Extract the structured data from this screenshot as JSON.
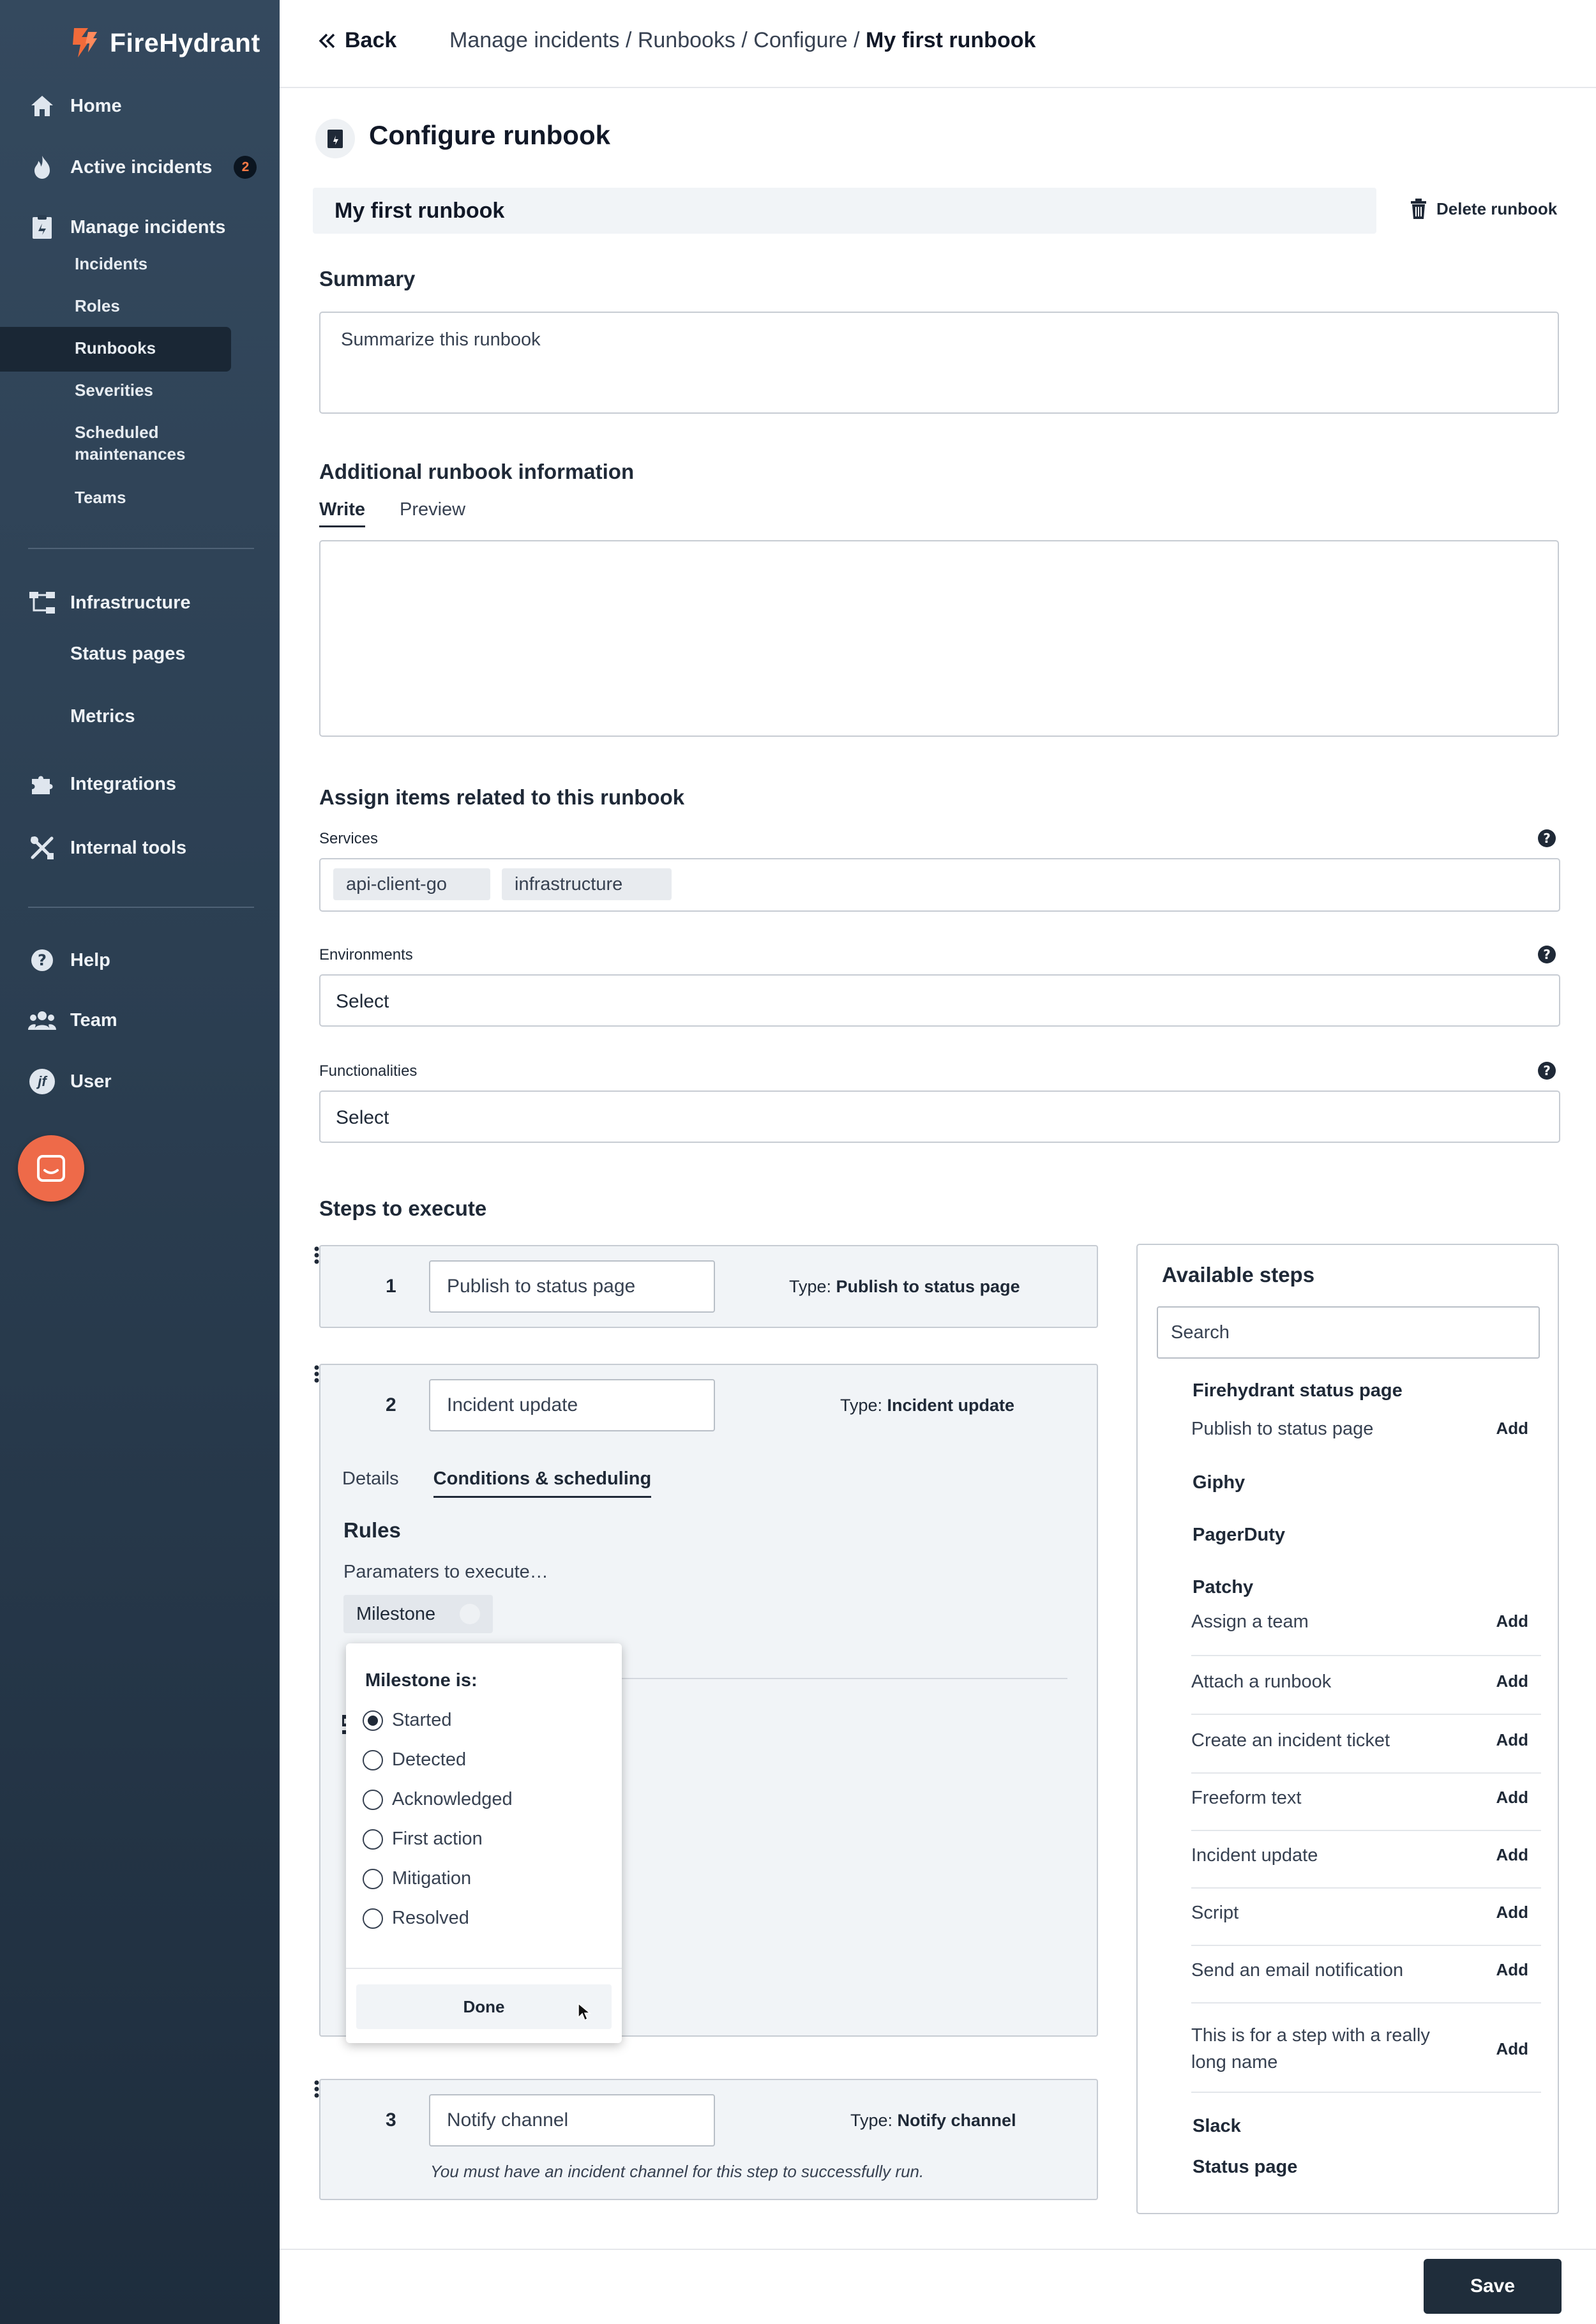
{
  "brand": {
    "name": "FireHydrant",
    "accent": "#f26b3a"
  },
  "sidebar": {
    "home": "Home",
    "active_incidents": "Active incidents",
    "active_incidents_count": "2",
    "manage_incidents": "Manage incidents",
    "sub": [
      "Incidents",
      "Roles",
      "Runbooks",
      "Severities",
      "Scheduled maintenances",
      "Teams"
    ],
    "infrastructure": "Infrastructure",
    "status_pages": "Status pages",
    "metrics": "Metrics",
    "integrations": "Integrations",
    "internal_tools": "Internal tools",
    "help": "Help",
    "team": "Team",
    "user": "User",
    "user_initials": "jf"
  },
  "header": {
    "back": "Back",
    "crumbs": "Manage incidents / Runbooks / Configure / ",
    "crumb_current": "My first runbook"
  },
  "page": {
    "title": "Configure runbook",
    "runbook_name": "My first runbook",
    "delete": "Delete runbook",
    "summary_label": "Summary",
    "summary_placeholder": "Summarize this runbook",
    "additional_label": "Additional runbook information",
    "tab_write": "Write",
    "tab_preview": "Preview",
    "assign_label": "Assign items related to this runbook",
    "services_label": "Services",
    "services": [
      "api-client-go",
      "infrastructure"
    ],
    "environments_label": "Environments",
    "environments_value": "Select",
    "functionalities_label": "Functionalities",
    "functionalities_value": "Select",
    "steps_label": "Steps to execute"
  },
  "steps": [
    {
      "num": "1",
      "name": "Publish to status page",
      "type_prefix": "Type: ",
      "type": "Publish to status page"
    },
    {
      "num": "2",
      "name": "Incident update",
      "type_prefix": "Type: ",
      "type": "Incident update",
      "tab_details": "Details",
      "tab_conditions": "Conditions & scheduling",
      "rules": "Rules",
      "params": "Paramaters to execute…",
      "chip": "Milestone"
    },
    {
      "num": "3",
      "name": "Notify channel",
      "type_prefix": "Type: ",
      "type": "Notify channel",
      "note": "You must have an incident channel for this step to successfully run."
    }
  ],
  "milestone_dropdown": {
    "title": "Milestone is:",
    "options": [
      "Started",
      "Detected",
      "Acknowledged",
      "First action",
      "Mitigation",
      "Resolved"
    ],
    "selected": "Started",
    "done": "Done"
  },
  "available": {
    "title": "Available steps",
    "search_placeholder": "Search",
    "groups": {
      "firehydrant": "Firehydrant status page",
      "giphy": "Giphy",
      "pagerduty": "PagerDuty",
      "patchy": "Patchy",
      "slack": "Slack",
      "status_page": "Status page"
    },
    "firehydrant_items": [
      "Publish to status page"
    ],
    "patchy_items": [
      "Assign a team",
      "Attach a runbook",
      "Create an incident ticket",
      "Freeform text",
      "Incident update",
      "Script",
      "Send an email notification",
      "This is for a step with a really long name"
    ],
    "add_label": "Add"
  },
  "footer": {
    "save": "Save"
  }
}
